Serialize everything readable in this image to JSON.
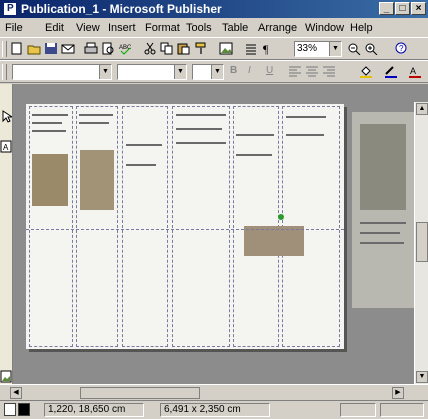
{
  "window": {
    "title": "Publication_1 - Microsoft Publisher",
    "app_icon_letter": "P"
  },
  "menu": [
    "File",
    "Edit",
    "View",
    "Insert",
    "Format",
    "Tools",
    "Table",
    "Arrange",
    "Window",
    "Help"
  ],
  "standard_toolbar": {
    "zoom": "33%"
  },
  "status": {
    "position": "1,220, 18,650 cm",
    "size": "6,491 x 2,350 cm"
  },
  "pages": [
    "1",
    "2"
  ]
}
